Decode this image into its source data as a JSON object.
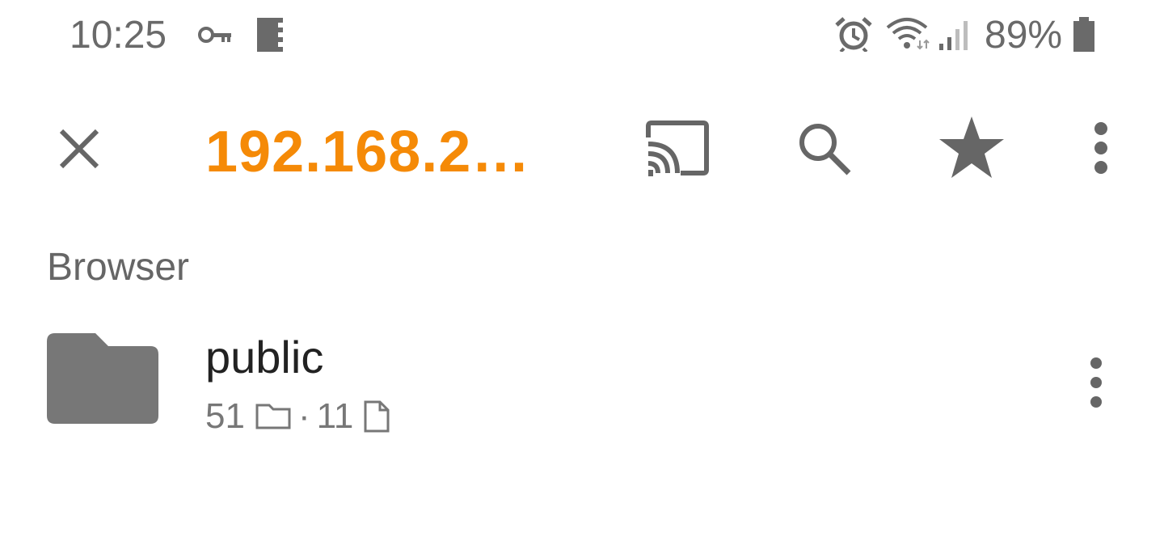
{
  "status_bar": {
    "time": "10:25",
    "battery_percent": "89%",
    "icons": [
      "key-icon",
      "sd-card-icon",
      "alarm-icon",
      "wifi-icon",
      "signal-icon",
      "battery-icon"
    ]
  },
  "toolbar": {
    "title": "192.168.2…",
    "title_color": "#f58a07",
    "actions": [
      "close-icon",
      "cast-icon",
      "search-icon",
      "star-icon",
      "more-vert-icon"
    ]
  },
  "section": {
    "header": "Browser"
  },
  "items": [
    {
      "name": "public",
      "folder_count": "51",
      "separator": "·",
      "file_count": "11",
      "icon": "folder-icon"
    }
  ],
  "colors": {
    "accent": "#f58a07",
    "icon_gray": "#666666",
    "text_primary": "#222222",
    "text_secondary": "#777777"
  }
}
